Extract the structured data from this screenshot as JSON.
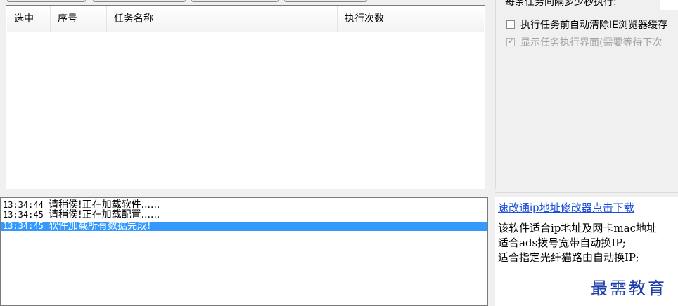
{
  "task_table": {
    "columns": [
      "选中",
      "序号",
      "任务名称",
      "执行次数"
    ],
    "rows": []
  },
  "settings": {
    "interval_label": "每条任务间隔多少秒执行:",
    "clear_ie_cache": {
      "label": "执行任务前自动清除IE浏览器缓存",
      "checked": false
    },
    "show_exec_ui": {
      "label": "显示任务执行界面(需要等待下次",
      "checked": true,
      "disabled": true
    }
  },
  "log": {
    "lines": [
      {
        "time": "13:34:44",
        "text": "请稍侯!正在加载软件......",
        "selected": false
      },
      {
        "time": "13:34:45",
        "text": "请稍侯!正在加载配置......",
        "selected": false
      },
      {
        "time": "13:34:45",
        "text": "软件加载所有数据完成!",
        "selected": true
      }
    ]
  },
  "info": {
    "download_link": "速改通ip地址修改器点击下载",
    "line1": "该软件适合ip地址及网卡mac地址",
    "line2": "适合ads拨号宽带自动换IP;",
    "line3": "适合指定光纤猫路由自动换IP;"
  },
  "watermark": "最需教育"
}
